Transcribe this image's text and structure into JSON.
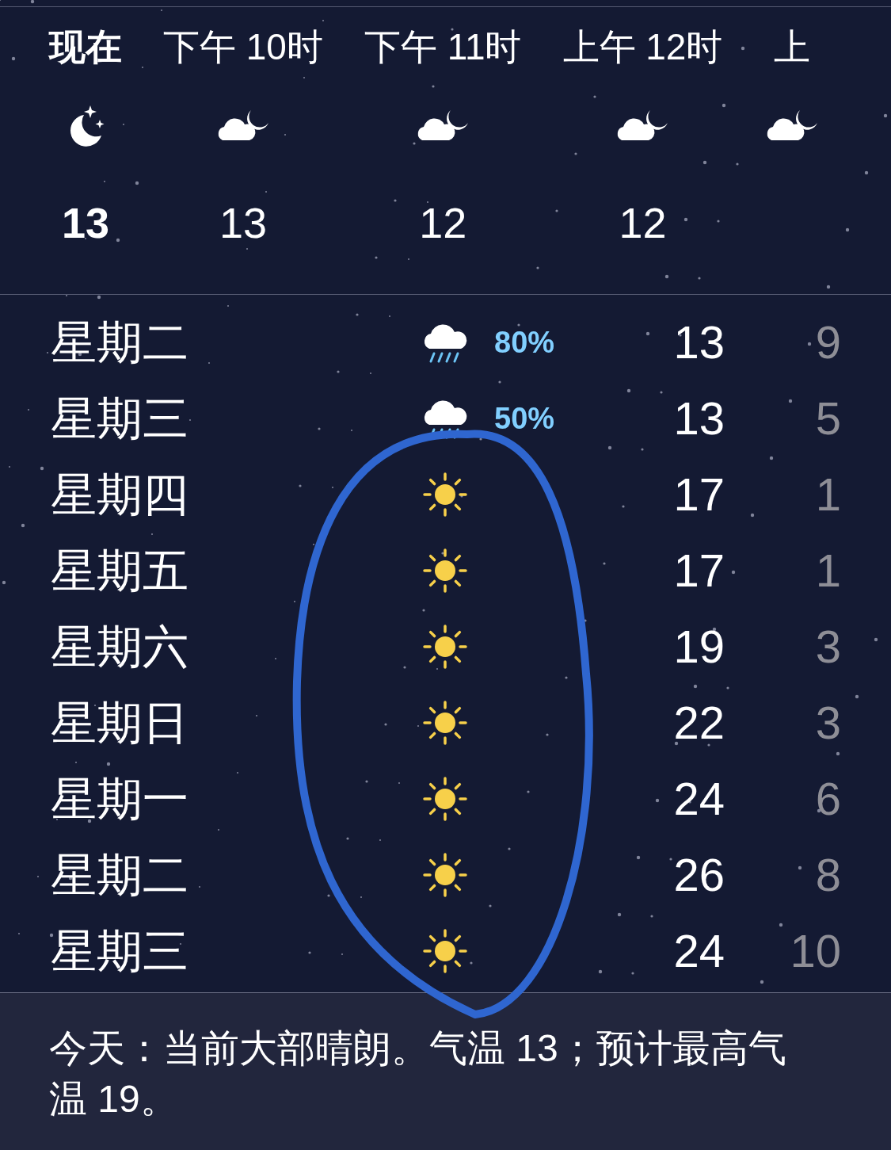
{
  "hourly": [
    {
      "label": "现在",
      "now": true,
      "kind": "moon",
      "temp": "13"
    },
    {
      "label": "下午 10时",
      "now": false,
      "kind": "cloudmoon",
      "temp": "13"
    },
    {
      "label": "下午 11时",
      "now": false,
      "kind": "cloudmoon",
      "temp": "12"
    },
    {
      "label": "上午 12时",
      "now": false,
      "kind": "cloudmoon",
      "temp": "12"
    },
    {
      "label": "上",
      "now": false,
      "kind": "cloudmoon"
    }
  ],
  "daily": [
    {
      "day": "星期二",
      "kind": "rain",
      "precip": "80%",
      "high": "13",
      "low": "9"
    },
    {
      "day": "星期三",
      "kind": "rain",
      "precip": "50%",
      "high": "13",
      "low": "5"
    },
    {
      "day": "星期四",
      "kind": "sun",
      "high": "17",
      "low": "1"
    },
    {
      "day": "星期五",
      "kind": "sun",
      "high": "17",
      "low": "1"
    },
    {
      "day": "星期六",
      "kind": "sun",
      "high": "19",
      "low": "3"
    },
    {
      "day": "星期日",
      "kind": "sun",
      "high": "22",
      "low": "3"
    },
    {
      "day": "星期一",
      "kind": "sun",
      "high": "24",
      "low": "6"
    },
    {
      "day": "星期二",
      "kind": "sun",
      "high": "26",
      "low": "8"
    },
    {
      "day": "星期三",
      "kind": "sun",
      "high": "24",
      "low": "10"
    }
  ],
  "summary": "今天：当前大部晴朗。气温 13；预计最高气温 19。",
  "annotation": {
    "kind": "ellipse",
    "color": "#2f66d0"
  }
}
